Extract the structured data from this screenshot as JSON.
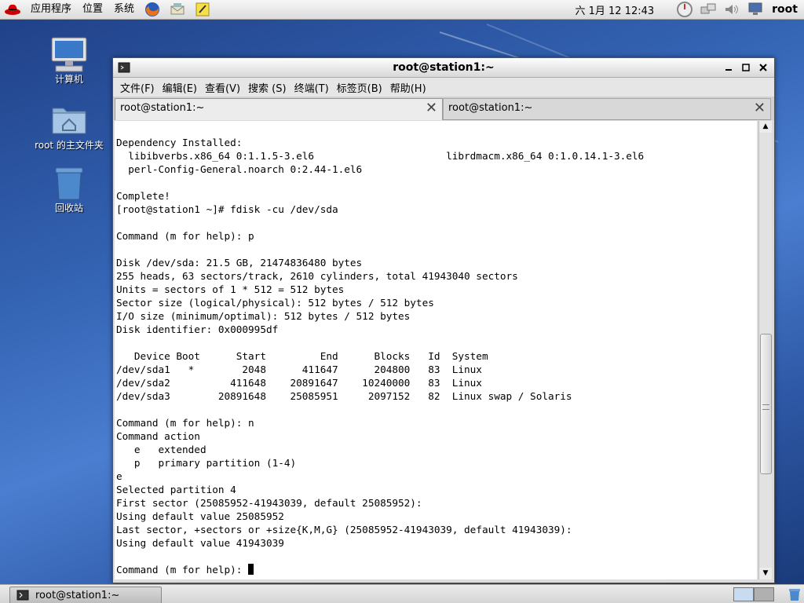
{
  "top_panel": {
    "menus": [
      "应用程序",
      "位置",
      "系统"
    ],
    "clock": "六  1月 12 12:43",
    "user": "root"
  },
  "desktop_icons": [
    {
      "label": "计算机",
      "icon": "computer-icon"
    },
    {
      "label": "root 的主文件夹",
      "icon": "home-folder-icon"
    },
    {
      "label": "回收站",
      "icon": "trash-icon"
    }
  ],
  "window": {
    "title": "root@station1:~",
    "menubar": [
      "文件(F)",
      "编辑(E)",
      "查看(V)",
      "搜索 (S)",
      "终端(T)",
      "标签页(B)",
      "帮助(H)"
    ],
    "tabs": [
      {
        "label": "root@station1:~",
        "active": true
      },
      {
        "label": "root@station1:~",
        "active": false
      }
    ],
    "terminal_lines": [
      "",
      "Dependency Installed:",
      "  libibverbs.x86_64 0:1.1.5-3.el6                      librdmacm.x86_64 0:1.0.14.1-3.el6",
      "  perl-Config-General.noarch 0:2.44-1.el6",
      "",
      "Complete!",
      "[root@station1 ~]# fdisk -cu /dev/sda",
      "",
      "Command (m for help): p",
      "",
      "Disk /dev/sda: 21.5 GB, 21474836480 bytes",
      "255 heads, 63 sectors/track, 2610 cylinders, total 41943040 sectors",
      "Units = sectors of 1 * 512 = 512 bytes",
      "Sector size (logical/physical): 512 bytes / 512 bytes",
      "I/O size (minimum/optimal): 512 bytes / 512 bytes",
      "Disk identifier: 0x000995df",
      "",
      "   Device Boot      Start         End      Blocks   Id  System",
      "/dev/sda1   *        2048      411647      204800   83  Linux",
      "/dev/sda2          411648    20891647    10240000   83  Linux",
      "/dev/sda3        20891648    25085951     2097152   82  Linux swap / Solaris",
      "",
      "Command (m for help): n",
      "Command action",
      "   e   extended",
      "   p   primary partition (1-4)",
      "e",
      "Selected partition 4",
      "First sector (25085952-41943039, default 25085952):",
      "Using default value 25085952",
      "Last sector, +sectors or +size{K,M,G} (25085952-41943039, default 41943039):",
      "Using default value 41943039",
      ""
    ],
    "prompt_line": "Command (m for help): ",
    "scroll_position": 0.68
  },
  "bottom_panel": {
    "task_label": "root@station1:~"
  }
}
